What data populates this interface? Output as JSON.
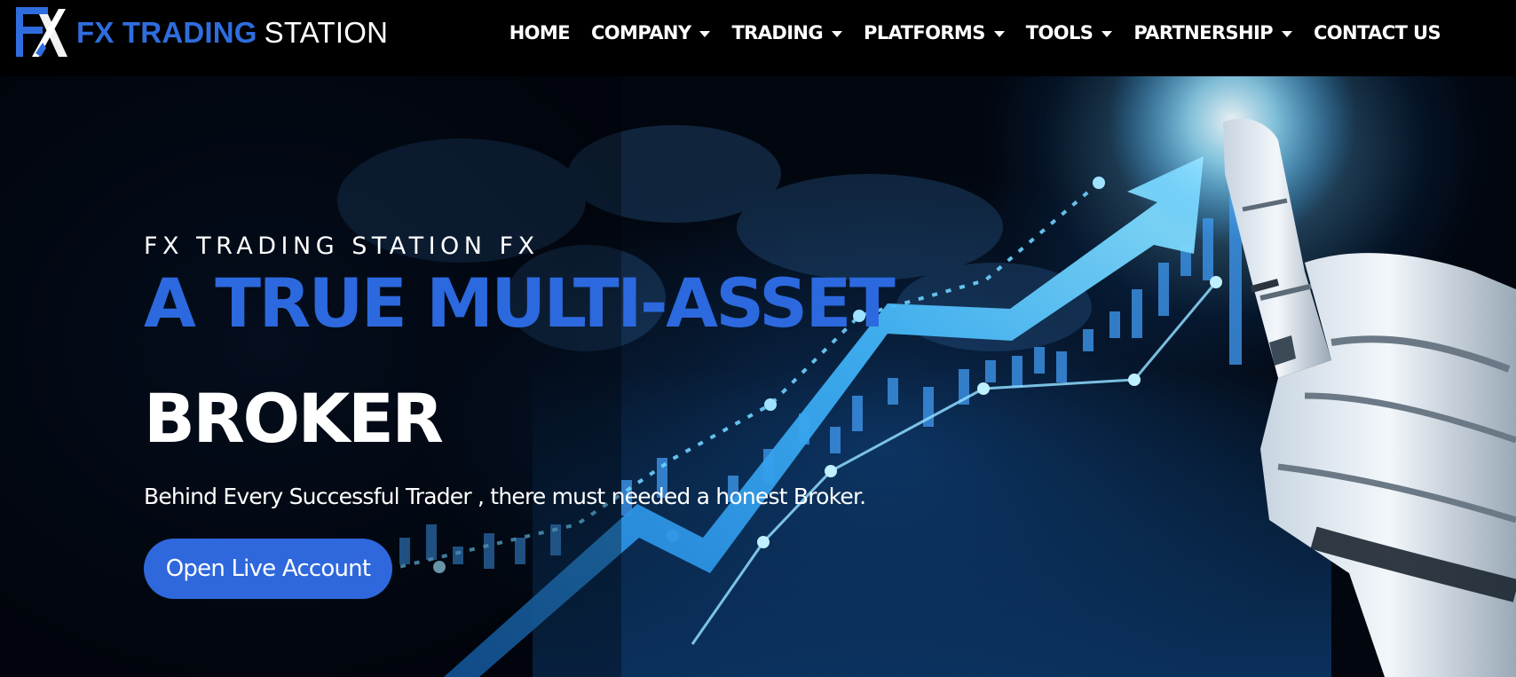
{
  "brand": {
    "name_strong": "FX TRADING",
    "name_light": "STATION",
    "colors": {
      "primary": "#2f6dde",
      "nav_bg": "#000000",
      "text": "#ffffff"
    }
  },
  "nav": {
    "items": [
      {
        "label": "HOME",
        "dropdown": false
      },
      {
        "label": "COMPANY",
        "dropdown": true
      },
      {
        "label": "TRADING",
        "dropdown": true
      },
      {
        "label": "PLATFORMS",
        "dropdown": true
      },
      {
        "label": "TOOLS",
        "dropdown": true
      },
      {
        "label": "PARTNERSHIP",
        "dropdown": true
      },
      {
        "label": "CONTACT US",
        "dropdown": false
      }
    ]
  },
  "hero": {
    "eyebrow": "FX TRADING STATION FX",
    "headline_blue": "A TRUE MULTI-ASSET",
    "headline_white": "BROKER",
    "tagline": "Behind Every Successful Trader , there must needed a honest Broker.",
    "cta_label": "Open Live Account",
    "background_icons": [
      "rising-arrow-chart-icon",
      "robot-hand-icon",
      "world-map-icon",
      "candlestick-icon"
    ]
  }
}
